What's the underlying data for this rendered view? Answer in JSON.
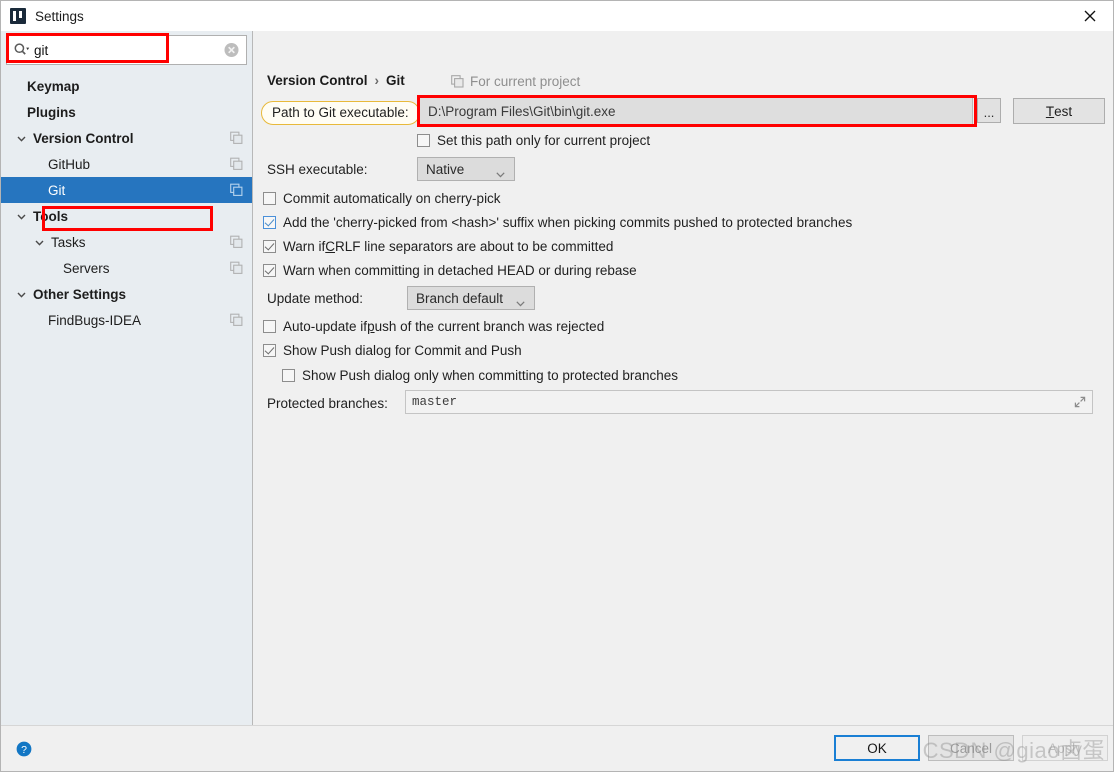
{
  "window": {
    "title": "Settings",
    "app_icon": "intellij-idea-icon",
    "close_icon": "close-icon"
  },
  "search": {
    "value": "git",
    "placeholder": "",
    "search_icon": "search-dropdown-icon",
    "clear_icon": "clear-circle-icon"
  },
  "sidebar": {
    "items": [
      {
        "label": "Keymap",
        "indent": 26,
        "bold": true,
        "chevron": "none",
        "copy_icon": false,
        "selected": false
      },
      {
        "label": "Plugins",
        "indent": 26,
        "bold": true,
        "chevron": "none",
        "copy_icon": false,
        "selected": false
      },
      {
        "label": "Version Control",
        "indent": 14,
        "bold": true,
        "chevron": "down",
        "copy_icon": true,
        "selected": false
      },
      {
        "label": "GitHub",
        "indent": 47,
        "bold": false,
        "chevron": "none",
        "copy_icon": true,
        "selected": false
      },
      {
        "label": "Git",
        "indent": 47,
        "bold": false,
        "chevron": "none",
        "copy_icon": true,
        "selected": true
      },
      {
        "label": "Tools",
        "indent": 14,
        "bold": true,
        "chevron": "down",
        "copy_icon": false,
        "selected": false
      },
      {
        "label": "Tasks",
        "indent": 32,
        "bold": false,
        "chevron": "down",
        "copy_icon": true,
        "selected": false
      },
      {
        "label": "Servers",
        "indent": 62,
        "bold": false,
        "chevron": "none",
        "copy_icon": true,
        "selected": false
      },
      {
        "label": "Other Settings",
        "indent": 14,
        "bold": true,
        "chevron": "down",
        "copy_icon": false,
        "selected": false
      },
      {
        "label": "FindBugs-IDEA",
        "indent": 47,
        "bold": false,
        "chevron": "none",
        "copy_icon": true,
        "selected": false
      }
    ]
  },
  "main": {
    "breadcrumb": {
      "parent": "Version Control",
      "separator": "›",
      "current": "Git"
    },
    "for_current_project": {
      "label": "For current project",
      "icon": "copy-icon"
    },
    "path_label": "Path to Git executable:",
    "path_value": "D:\\Program Files\\Git\\bin\\git.exe",
    "browse_button": "...",
    "test_button": {
      "underlined": "T",
      "rest": "est"
    },
    "set_path_only": {
      "label": "Set this path only for current project",
      "checked": false
    },
    "ssh_label": "SSH executable:",
    "ssh_value": "Native",
    "checkboxes": [
      {
        "label": "Commit automatically on cherry-pick",
        "checked": false,
        "focus": false
      },
      {
        "label": "Add the 'cherry-picked from <hash>' suffix when picking commits pushed to protected branches",
        "checked": true,
        "focus": true
      },
      {
        "label_pre": "Warn if ",
        "label_mnemonic": "C",
        "label_post": "RLF line separators are about to be committed",
        "checked": true,
        "focus": false
      },
      {
        "label": "Warn when committing in detached HEAD or during rebase",
        "checked": true,
        "focus": false
      }
    ],
    "update_method_label": "Update method:",
    "update_method_value": "Branch default",
    "auto_update": {
      "label_pre": "Auto-update if ",
      "label_mnemonic": "p",
      "label_post": "ush of the current branch was rejected",
      "checked": false
    },
    "show_push": {
      "label": "Show Push dialog for Commit and Push",
      "checked": true
    },
    "show_push_protected": {
      "label": "Show Push dialog only when committing to protected branches",
      "checked": false
    },
    "protected_label": "Protected branches:",
    "protected_value": "master",
    "expand_icon": "expand-arrows-icon"
  },
  "footer": {
    "help_icon": "help-question-icon",
    "ok": "OK",
    "cancel": "Cancel",
    "apply": "Apply",
    "watermark": "CSDN @giao卤蛋"
  },
  "colors": {
    "selection_blue": "#2675bf",
    "annotation_red": "#ff0000",
    "highlight_yellow": "#e8b93a",
    "ok_border_blue": "#1a7fd4"
  }
}
